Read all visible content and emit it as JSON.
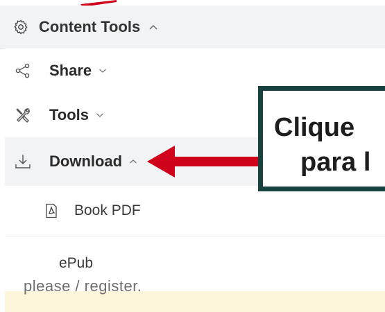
{
  "header": {
    "title": "Content Tools",
    "icon": "gear-icon",
    "chevron_icon": "chevron-up-icon"
  },
  "menu": {
    "items": [
      {
        "label": "Share",
        "icon": "share-icon",
        "chevron": "chevron-down-icon"
      },
      {
        "label": "Tools",
        "icon": "tools-icon",
        "chevron": "chevron-down-icon"
      },
      {
        "label": "Download",
        "icon": "download-icon",
        "chevron": "chevron-up-icon",
        "expanded": true
      }
    ],
    "download_options": [
      {
        "label": "Book PDF",
        "icon": "pdf-icon"
      },
      {
        "label": "ePub"
      }
    ]
  },
  "callout": {
    "line1": "Clique",
    "line2": "para l"
  },
  "below": {
    "text": "please / register."
  },
  "colors": {
    "accent_red": "#d0021b",
    "callout_border": "#17423d",
    "header_bg": "#f1f3f4",
    "below_bg": "#fdf6da"
  }
}
